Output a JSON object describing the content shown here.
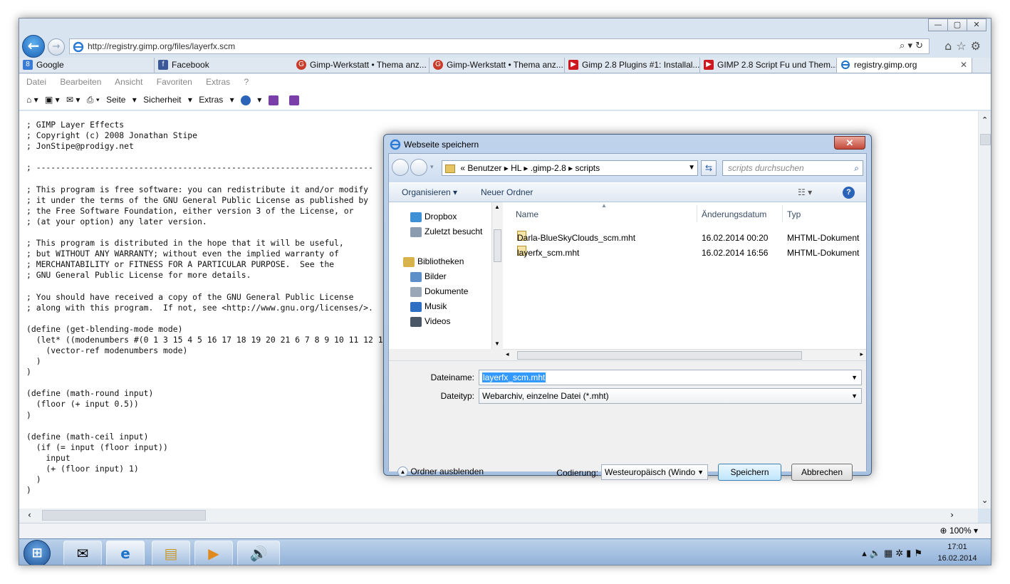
{
  "browser": {
    "address_url": "http://registry.gimp.org/files/layerfx.scm",
    "window_buttons": [
      "—",
      "▢",
      "✕"
    ],
    "favorites": [
      {
        "label": "Google",
        "color": "#3a7bd5"
      },
      {
        "label": "Facebook",
        "color": "#3b5998"
      }
    ],
    "tabs": [
      {
        "label": "Gimp-Werkstatt • Thema anz...",
        "color": "#c83b2a"
      },
      {
        "label": "Gimp-Werkstatt • Thema anz...",
        "color": "#c83b2a"
      },
      {
        "label": "Gimp 2.8 Plugins #1: Installal...",
        "color": "#cc181e"
      },
      {
        "label": "GIMP 2.8 Script Fu und Them...",
        "color": "#cc181e"
      },
      {
        "label": "registry.gimp.org",
        "color": "#1e73c8",
        "active": true
      }
    ],
    "menu": [
      "Datei",
      "Bearbeiten",
      "Ansicht",
      "Favoriten",
      "Extras",
      "?"
    ],
    "commands": {
      "seite": "Seite",
      "sicherheit": "Sicherheit",
      "extras": "Extras"
    },
    "zoom": "100%"
  },
  "code": "; GIMP Layer Effects\n; Copyright (c) 2008 Jonathan Stipe\n; JonStipe@prodigy.net\n\n; ---------------------------------------------------------------------\n\n; This program is free software: you can redistribute it and/or modify\n; it under the terms of the GNU General Public License as published by\n; the Free Software Foundation, either version 3 of the License, or\n; (at your option) any later version.\n\n; This program is distributed in the hope that it will be useful,\n; but WITHOUT ANY WARRANTY; without even the implied warranty of\n; MERCHANTABILITY or FITNESS FOR A PARTICULAR PURPOSE.  See the\n; GNU General Public License for more details.\n\n; You should have received a copy of the GNU General Public License\n; along with this program.  If not, see <http://www.gnu.org/licenses/>.\n\n(define (get-blending-mode mode)\n  (let* ((modenumbers #(0 1 3 15 4 5 16 17 18 19 20 21 6 7 8 9 10 11 12 13 14)))\n    (vector-ref modenumbers mode)\n  )\n)\n\n(define (math-round input)\n  (floor (+ input 0.5))\n)\n\n(define (math-ceil input)\n  (if (= input (floor input))\n    input\n    (+ (floor input) 1)\n  )\n)",
  "dialog": {
    "title": "Webseite speichern",
    "close": "✕",
    "path": [
      "«",
      "Benutzer",
      "HL",
      ".gimp-2.8",
      "scripts"
    ],
    "search_placeholder": "scripts durchsuchen",
    "toolbar": {
      "organize": "Organisieren ▾",
      "new_folder": "Neuer Ordner",
      "help": "?"
    },
    "nav": [
      {
        "label": "Dropbox",
        "color": "#3d8fd6",
        "indent": 1
      },
      {
        "label": "Zuletzt besucht",
        "color": "#8a9bb0",
        "indent": 1
      },
      {
        "label": "Bibliotheken",
        "color": "#d8b24a",
        "indent": 0
      },
      {
        "label": "Bilder",
        "color": "#5c8fc7",
        "indent": 1
      },
      {
        "label": "Dokumente",
        "color": "#9aa7b6",
        "indent": 1
      },
      {
        "label": "Musik",
        "color": "#2e6fc4",
        "indent": 1
      },
      {
        "label": "Videos",
        "color": "#4a5666",
        "indent": 1
      }
    ],
    "columns": {
      "name": "Name",
      "date": "Änderungsdatum",
      "type": "Typ"
    },
    "files": [
      {
        "name": "Darla-BlueSkyClouds_scm.mht",
        "date": "16.02.2014 00:20",
        "type": "MHTML-Dokument"
      },
      {
        "name": "layerfx_scm.mht",
        "date": "16.02.2014 16:56",
        "type": "MHTML-Dokument"
      }
    ],
    "filename_label": "Dateiname:",
    "filename_value": "layerfx_scm.mht",
    "filetype_label": "Dateityp:",
    "filetype_value": "Webarchiv, einzelne Datei (*.mht)",
    "hide_folders": "Ordner ausblenden",
    "encoding_label": "Codierung:",
    "encoding_value": "Westeuropäisch (Windo",
    "save": "Speichern",
    "cancel": "Abbrechen"
  },
  "taskbar": {
    "time": "17:01",
    "date": "16.02.2014"
  }
}
